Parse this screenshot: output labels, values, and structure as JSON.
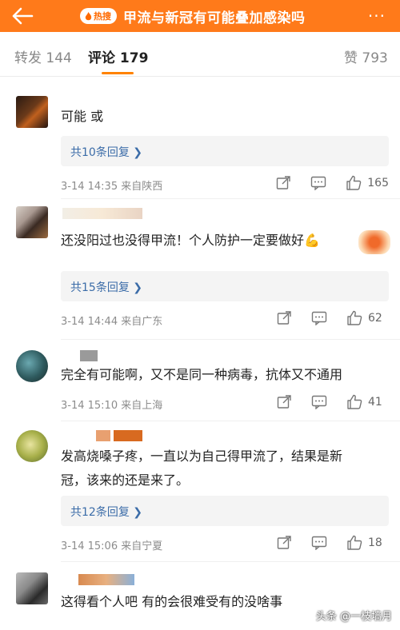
{
  "header": {
    "hot_badge": "热搜",
    "title": "甲流与新冠有可能叠加感染吗",
    "more": "···"
  },
  "tabs": {
    "repost": "转发 144",
    "comment": "评论 179",
    "like": "赞 793"
  },
  "comments": [
    {
      "text": "可能 或",
      "reply": "共10条回复 ❯",
      "meta": "3-14 14:35  来自陕西",
      "likes": "165"
    },
    {
      "text": "还没阳过也没得甲流！个人防护一定要做好💪",
      "reply": "共15条回复 ❯",
      "meta": "3-14 14:44  来自广东",
      "likes": "62"
    },
    {
      "text": "完全有可能啊，又不是同一种病毒，抗体又不通用",
      "meta": "3-14 15:10  来自上海",
      "likes": "41"
    },
    {
      "text_line1": "发高烧嗓子疼，一直以为自己得甲流了，结果是新",
      "text_line2": "冠，该来的还是来了。",
      "reply": "共12条回复 ❯",
      "meta": "3-14 15:06  来自宁夏",
      "likes": "18"
    },
    {
      "text": "这得看个人吧 有的会很难受有的没啥事"
    }
  ],
  "watermark": "头条 @一枝墙月",
  "colors": {
    "accent": "#ff7a1a",
    "link": "#3b6ca8",
    "meta": "#8c8c8c"
  }
}
